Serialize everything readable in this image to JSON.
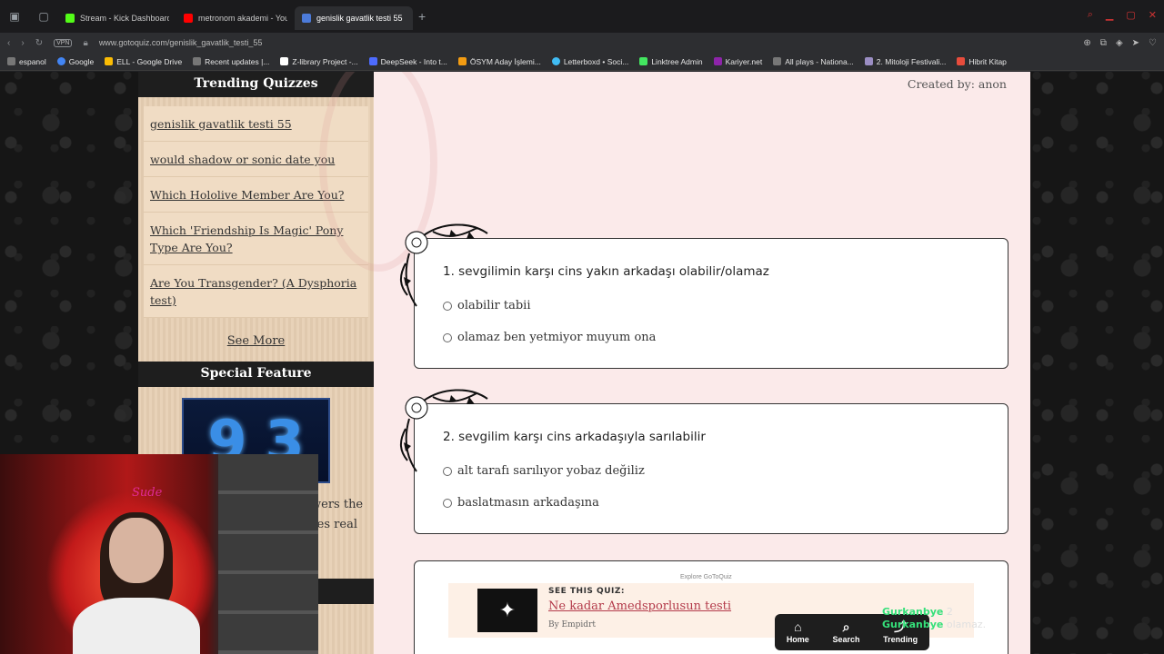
{
  "browser": {
    "tabs": [
      {
        "label": "Stream - Kick Dashboard",
        "color": "#53fc18",
        "active": false
      },
      {
        "label": "metronom akademi - YouTube",
        "color": "#ff0000",
        "active": false
      },
      {
        "label": "genislik gavatlik testi 55",
        "color": "#4c7bd9",
        "active": true
      }
    ],
    "new_tab": "+",
    "vpn": "VPN",
    "url": "www.gotoquiz.com/genislik_gavatlik_testi_55",
    "bookmarks": [
      "espanol",
      "Google",
      "ELL - Google Drive",
      "Recent updates |...",
      "Z-library Project -...",
      "DeepSeek - Into t...",
      "ÖSYM Aday İşlemi...",
      "Letterboxd • Soci...",
      "Linktree Admin",
      "Kariyer.net",
      "All plays - Nationa...",
      "2. Mitoloji Festivali...",
      "Hibrit Kitap"
    ]
  },
  "sidebar": {
    "trending_title": "Trending Quizzes",
    "trending": [
      "genislik gavatlik testi 55",
      "would shadow or sonic date you",
      "Which Hololive Member Are You?",
      "Which 'Friendship Is Magic' Pony Type Are You?",
      "Are You Transgender? (A Dysphoria test)"
    ],
    "see_more": "See More",
    "special_title": "Special Feature",
    "special_digits": [
      "9",
      "3"
    ],
    "special_text_1": "wers the",
    "special_text_2": "ses real"
  },
  "quiz": {
    "created_by": "Created by: anon",
    "questions": [
      {
        "text": "1. sevgilimin karşı cins yakın arkadaşı olabilir/olamaz",
        "options": [
          "olabilir tabii",
          "olamaz ben yetmiyor muyum ona"
        ]
      },
      {
        "text": "2. sevgilim karşı cins arkadaşıyla sarılabilir",
        "options": [
          "alt tarafı sarılıyor yobaz değiliz",
          "baslatmasın arkadaşına"
        ]
      }
    ],
    "promo": {
      "explore": "Explore GoToQuiz",
      "see_this": "SEE THIS QUIZ:",
      "title": "Ne kadar Amedsporlusun testi",
      "by": "By Empidrt"
    }
  },
  "nav": {
    "home": "Home",
    "search": "Search",
    "trending": "Trending"
  },
  "chat": [
    {
      "name": "Gurkanbye",
      "msg": "2"
    },
    {
      "name": "Gurkanbye",
      "msg": "olamaz."
    }
  ],
  "webcam": {
    "sign": "Sude"
  }
}
